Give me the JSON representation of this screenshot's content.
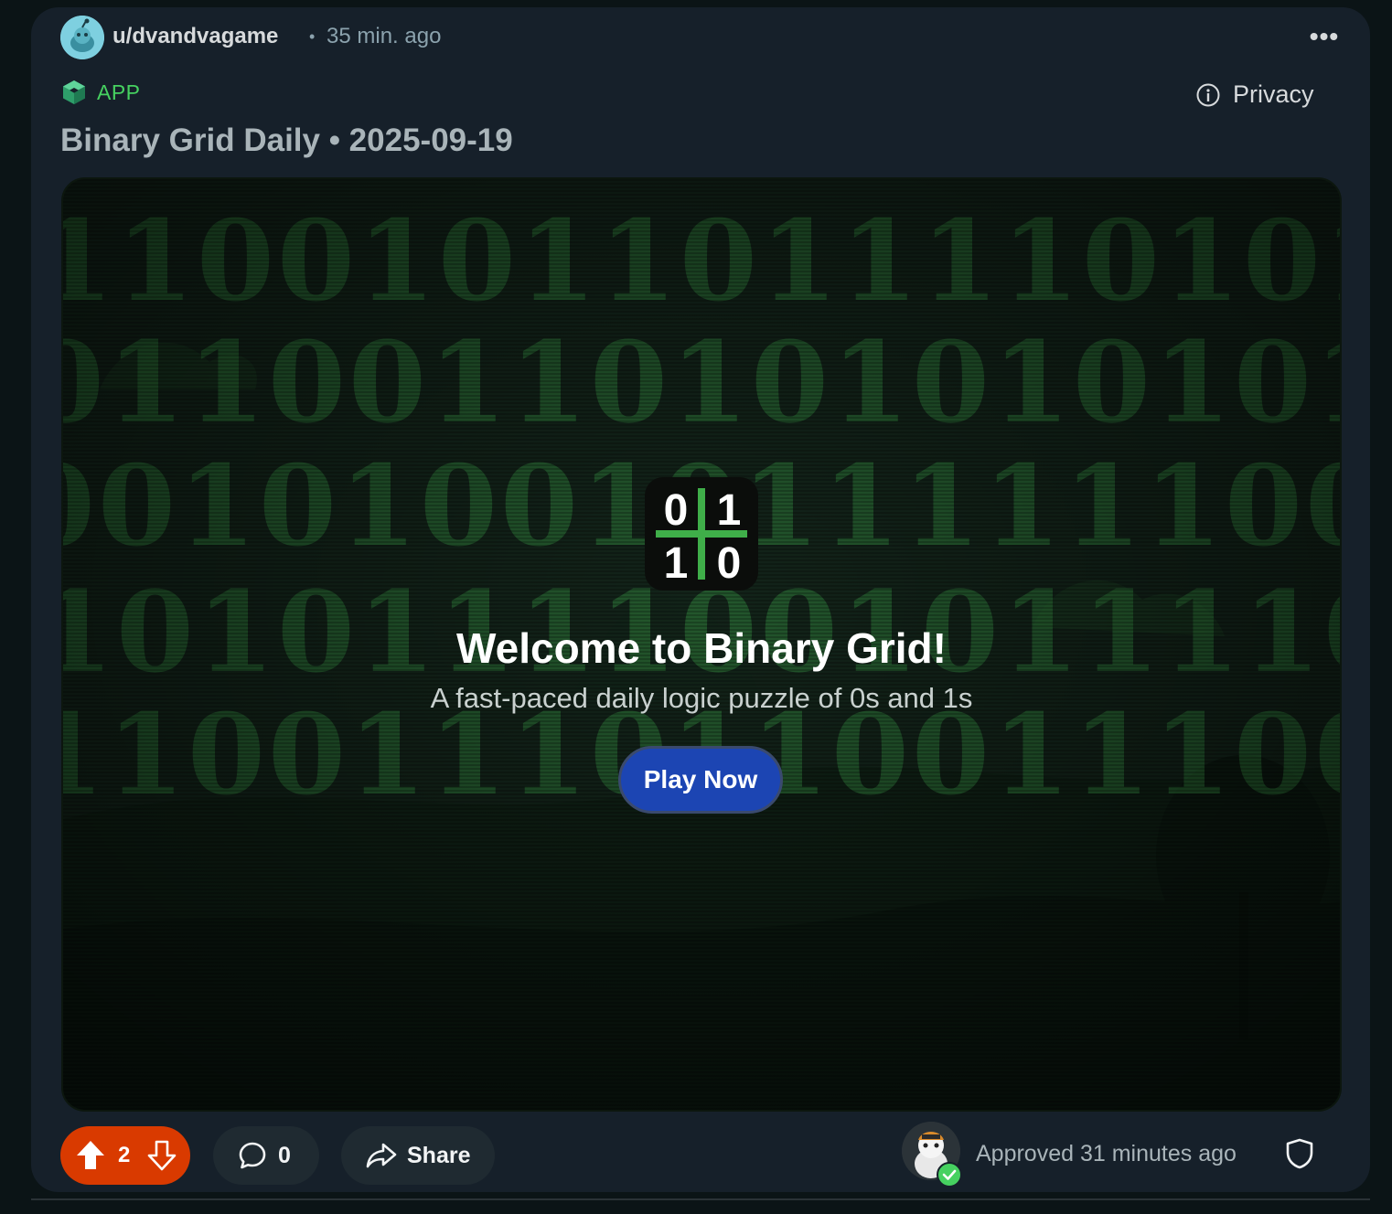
{
  "post": {
    "username": "u/dvandvagame",
    "time": "35 min. ago",
    "app_label": "APP",
    "privacy_label": "Privacy",
    "title": "Binary Grid Daily • 2025-09-19"
  },
  "game": {
    "logo": {
      "top_left": "0",
      "top_right": "1",
      "bottom_left": "1",
      "bottom_right": "0"
    },
    "welcome": "Welcome to Binary Grid!",
    "subtitle": "A fast-paced daily logic puzzle of 0s and 1s",
    "play_label": "Play Now",
    "background_rows": [
      "110010110111101010",
      "01100110101010101",
      "00101001011111100",
      "10101111001011110",
      "11001110110011100"
    ]
  },
  "footer": {
    "score": "2",
    "comments": "0",
    "share_label": "Share",
    "approved_text": "Approved 31 minutes ago"
  },
  "colors": {
    "card_bg": "#16202a",
    "page_bg": "#0b1416",
    "upvote_active": "#d93a00",
    "app_green": "#46d160",
    "play_button": "#1c45b3",
    "matrix_green": "#2f7a3a"
  },
  "icons": [
    "snoo-avatar-icon",
    "more-options-icon",
    "app-cube-icon",
    "info-icon",
    "upvote-icon",
    "downvote-icon",
    "comment-icon",
    "share-icon",
    "mod-avatar-icon",
    "approved-check-icon",
    "shield-icon"
  ]
}
